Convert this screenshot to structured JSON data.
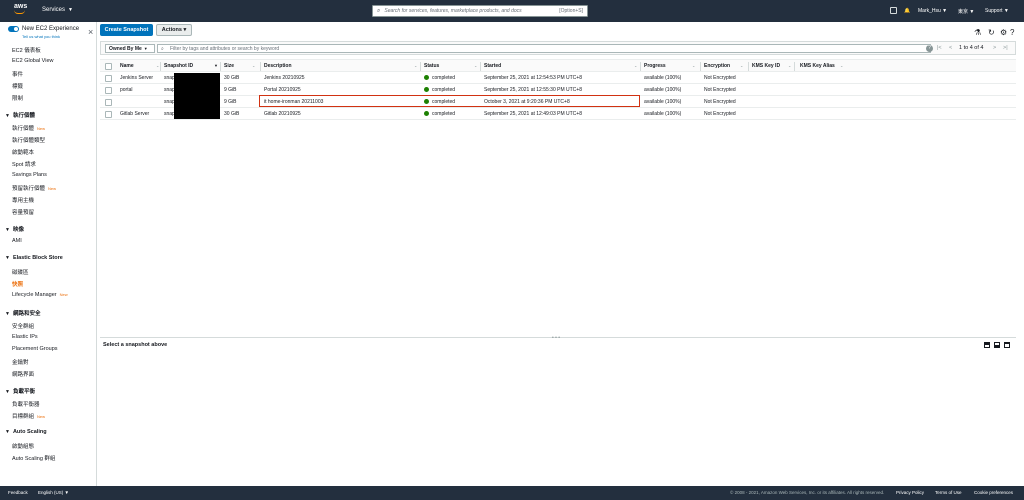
{
  "topbar": {
    "logo_text": "aws",
    "services": "Services",
    "search_placeholder": "Search for services, features, marketplace products, and docs",
    "search_shortcut": "[Option+S]",
    "account": "Mark_Hsu",
    "region": "東京",
    "support": "Support"
  },
  "sidebar": {
    "toggle_label": "New EC2 Experience",
    "toggle_sub": "Tell us what you think",
    "items": {
      "dashboard": "EC2 儀表板",
      "global_view": "EC2 Global View",
      "events": "事件",
      "tags": "標籤",
      "limits": "限制",
      "instances_head": "執行個體",
      "instances": "執行個體",
      "instance_types": "執行個體類型",
      "launch_templates": "啟動範本",
      "spot": "Spot 請求",
      "savings_plans": "Savings Plans",
      "reserved": "預留執行個體",
      "dedicated": "專用主機",
      "capacity": "容量預留",
      "images_head": "映像",
      "ami": "AMI",
      "ebs_head": "Elastic Block Store",
      "volumes": "磁碟區",
      "snapshots": "快照",
      "lifecycle": "Lifecycle Manager",
      "network_head": "網路和安全",
      "security_groups": "安全群組",
      "elastic_ips": "Elastic IPs",
      "placement": "Placement Groups",
      "key_pairs": "金鑰對",
      "interfaces": "網路界面",
      "lb_head": "負載平衡",
      "load_balancers": "負載平衡器",
      "target_groups": "目標群組",
      "as_head": "Auto Scaling",
      "launch_configs": "啟動組態",
      "as_groups": "Auto Scaling 群組"
    },
    "new_badge": "New"
  },
  "toolbar": {
    "create": "Create Snapshot",
    "actions": "Actions"
  },
  "filter": {
    "owned": "Owned By Me",
    "placeholder": "Filter by tags and attributes or search by keyword",
    "help": "?",
    "pager_text": "1 to 4 of 4"
  },
  "table": {
    "headers": {
      "name": "Name",
      "snapshot_id": "Snapshot ID",
      "size": "Size",
      "description": "Description",
      "status": "Status",
      "started": "Started",
      "progress": "Progress",
      "encryption": "Encryption",
      "kms_id": "KMS Key ID",
      "kms_alias": "KMS Key Alias"
    },
    "rows": [
      {
        "name": "Jenkins Server",
        "snapshot_id": "snap",
        "size": "30 GiB",
        "description": "Jenkins 20210925",
        "status": "completed",
        "started": "September 25, 2021 at 12:54:53 PM UTC+8",
        "progress": "available (100%)",
        "encryption": "Not Encrypted"
      },
      {
        "name": "portal",
        "snapshot_id": "snap",
        "size": "9 GiB",
        "description": "Portal 20210925",
        "status": "completed",
        "started": "September 25, 2021 at 12:55:30 PM UTC+8",
        "progress": "available (100%)",
        "encryption": "Not Encrypted"
      },
      {
        "name": "",
        "snapshot_id": "snap",
        "size": "9 GiB",
        "description": "it home-ironman 20211003",
        "status": "completed",
        "started": "October 3, 2021 at 9:20:36 PM UTC+8",
        "progress": "available (100%)",
        "encryption": "Not Encrypted"
      },
      {
        "name": "Gitlab Server",
        "snapshot_id": "snap",
        "size": "30 GiB",
        "description": "Gitlab 20210925",
        "status": "completed",
        "started": "September 25, 2021 at 12:49:03 PM UTC+8",
        "progress": "available (100%)",
        "encryption": "Not Encrypted"
      }
    ]
  },
  "details": {
    "title": "Select a snapshot above"
  },
  "footer": {
    "feedback": "Feedback",
    "language": "English (US)",
    "copyright": "© 2008 - 2021, Amazon Web Services, Inc. or its affiliates. All rights reserved.",
    "privacy": "Privacy Policy",
    "terms": "Terms of Use",
    "cookies": "Cookie preferences"
  },
  "colors": {
    "nav_bg": "#232f3e",
    "primary": "#0073bb",
    "accent": "#ec7211",
    "success": "#1d8102",
    "highlight": "#d13212"
  }
}
